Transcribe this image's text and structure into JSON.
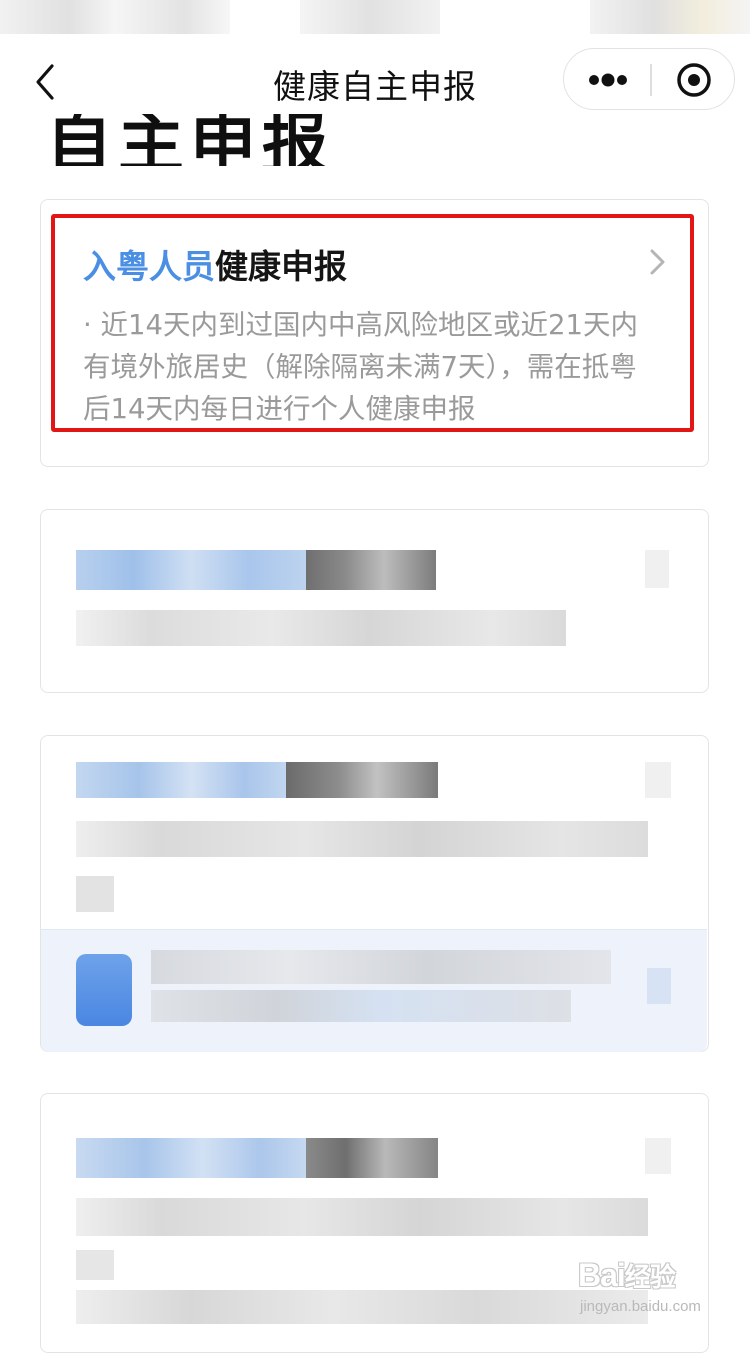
{
  "nav": {
    "title": "健康自主申报",
    "back_icon": "chevron-left-icon",
    "more_icon": "more-dots-icon",
    "close_icon": "target-close-icon"
  },
  "page": {
    "heading": "自主申报"
  },
  "cards": [
    {
      "title_highlight": "入粤人员",
      "title_rest": "健康申报",
      "description": "· 近14天内到过国内中高风险地区或近21天内有境外旅居史（解除隔离未满7天），需在抵粤后14天内每日进行个人健康申报",
      "chevron_icon": "chevron-right-icon"
    }
  ],
  "watermark": {
    "logo": "Bai",
    "logo_cn": "经验",
    "url": "jingyan.baidu.com"
  },
  "colors": {
    "accent_blue": "#4a8fe4",
    "highlight_red": "#e31616",
    "description_gray": "#9a9a9a",
    "notice_bg": "#eef3fb"
  }
}
